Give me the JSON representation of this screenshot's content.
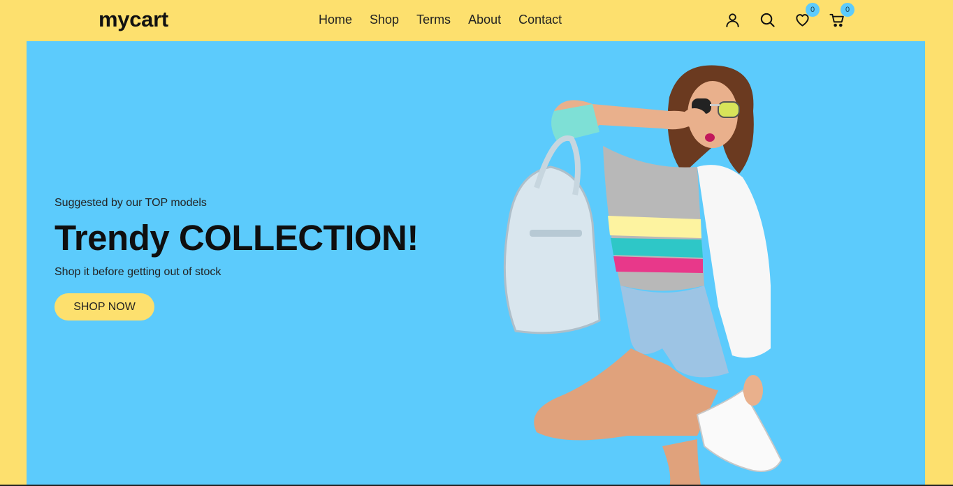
{
  "header": {
    "brand": "mycart",
    "nav": [
      "Home",
      "Shop",
      "Terms",
      "About",
      "Contact"
    ],
    "icons": {
      "account": "user-icon",
      "search": "search-icon",
      "wishlist": "heart-icon",
      "cart": "cart-icon"
    },
    "wishlist_count": "0",
    "cart_count": "0"
  },
  "hero": {
    "kicker": "Suggested by our TOP models",
    "title": "Trendy COLLECTION!",
    "subtitle": "Shop it before getting out of stock",
    "cta": "SHOP NOW"
  },
  "colors": {
    "page_background": "#fde06e",
    "hero_background": "#5ccbfc",
    "button_background": "#fde06e",
    "badge_background": "#5ccbfc"
  }
}
